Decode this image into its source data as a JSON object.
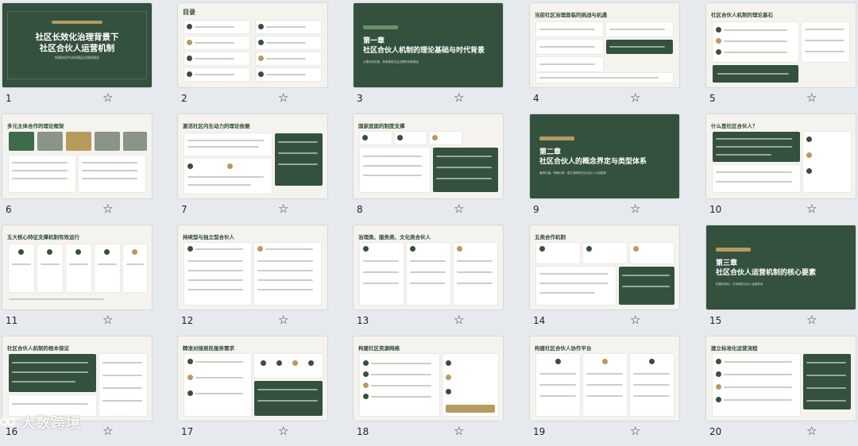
{
  "slides": [
    {
      "n": "1",
      "kind": "title-dark",
      "title": "社区长效化治理背景下\n社区合伙人运营机制",
      "subtitle": "构建协同共治的基层治理新格局"
    },
    {
      "n": "2",
      "kind": "toc",
      "title": "目录"
    },
    {
      "n": "3",
      "kind": "chapter",
      "title": "第一章\n社区合伙人机制的理论基础与时代背景",
      "subtitle": "从理论到实践，探索基层社会治理的创新路径"
    },
    {
      "n": "4",
      "kind": "content",
      "title": "当前社区治理面临的挑战与机遇"
    },
    {
      "n": "5",
      "kind": "content",
      "title": "社区合伙人机制的理论基石"
    },
    {
      "n": "6",
      "kind": "content",
      "title": "多元主体合作的理论框架"
    },
    {
      "n": "7",
      "kind": "content",
      "title": "激活社区内生动力的理论依据"
    },
    {
      "n": "8",
      "kind": "content",
      "title": "国家层面的制度支撑"
    },
    {
      "n": "9",
      "kind": "chapter",
      "title": "第二章\n社区合伙人的概念界定与类型体系",
      "subtitle": "厘清内涵，明确分类：建立清晰的社区合伙人认知框架"
    },
    {
      "n": "10",
      "kind": "content",
      "title": "什么是社区合伙人？"
    },
    {
      "n": "11",
      "kind": "content",
      "title": "五大核心特征支撑机制有效运行"
    },
    {
      "n": "12",
      "kind": "content",
      "title": "持续型与独立型合伙人"
    },
    {
      "n": "13",
      "kind": "content",
      "title": "治理类、服务类、文化类合伙人"
    },
    {
      "n": "14",
      "kind": "content",
      "title": "五类合作机制"
    },
    {
      "n": "15",
      "kind": "chapter",
      "title": "第三章\n社区合伙人运营机制的核心要素",
      "subtitle": "构建系统化、可持续的合伙人运营体系"
    },
    {
      "n": "16",
      "kind": "content",
      "title": "社区合伙人机制的根本保证"
    },
    {
      "n": "17",
      "kind": "content",
      "title": "精准对接居民服务需求"
    },
    {
      "n": "18",
      "kind": "content",
      "title": "构建社区资源网络"
    },
    {
      "n": "19",
      "kind": "content",
      "title": "构建社区合伙人协作平台"
    },
    {
      "n": "20",
      "kind": "content",
      "title": "建立标准化运营流程"
    }
  ],
  "star_icon": "☆",
  "watermark": "大数跨境",
  "colors": {
    "primary": "#34513e",
    "accent": "#b89a5f",
    "bg": "#f5f3ee"
  }
}
